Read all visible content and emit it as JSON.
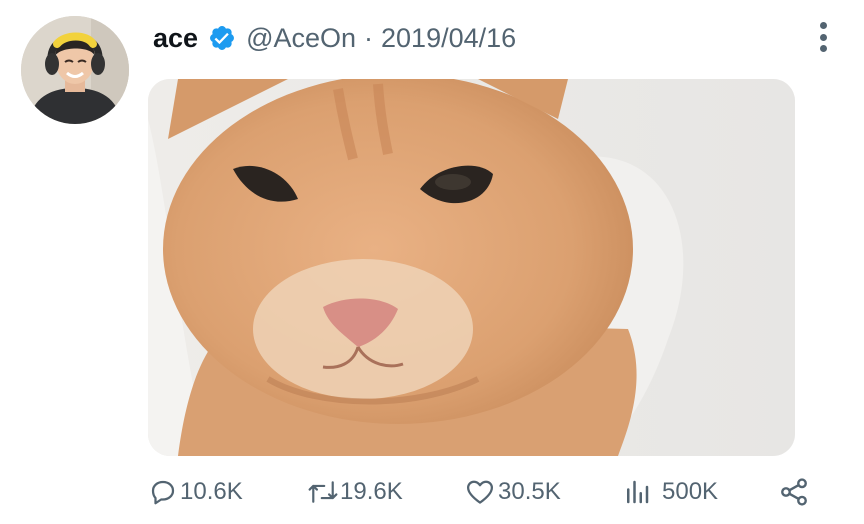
{
  "tweet": {
    "author_name": "ace",
    "handle": "@AceOn",
    "separator": "·",
    "date": "2019/04/16",
    "verified": true,
    "avatar_icon": "avatar-photo",
    "media_icon": "cat-photo"
  },
  "actions": {
    "replies": "10.6K",
    "retweets": "19.6K",
    "likes": "30.5K",
    "views": "500K"
  },
  "colors": {
    "text": "#0f1419",
    "secondary": "#536471",
    "verified": "#1d9bf0"
  }
}
